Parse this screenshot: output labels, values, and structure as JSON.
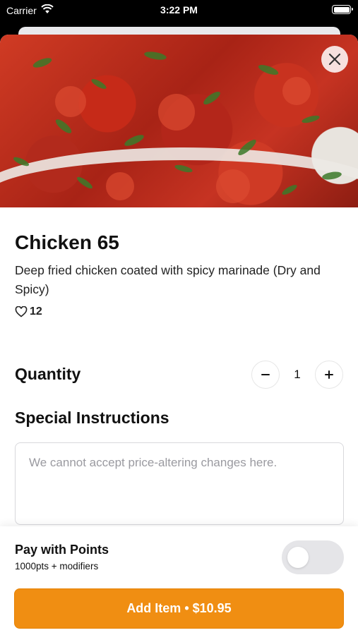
{
  "status_bar": {
    "carrier": "Carrier",
    "time": "3:22 PM"
  },
  "item": {
    "title": "Chicken 65",
    "description": "Deep fried chicken coated with spicy marinade (Dry and Spicy)",
    "likes": "12",
    "image_icon": "food-photo"
  },
  "quantity": {
    "label": "Quantity",
    "value": "1"
  },
  "special_instructions": {
    "label": "Special Instructions",
    "placeholder": "We cannot accept price-altering changes here."
  },
  "points": {
    "title": "Pay with Points",
    "subtitle": "1000pts + modifiers",
    "enabled": false
  },
  "add_button": {
    "label": "Add Item • $10.95"
  },
  "colors": {
    "accent": "#f08e12",
    "toggle_off": "#e5e5e8"
  }
}
